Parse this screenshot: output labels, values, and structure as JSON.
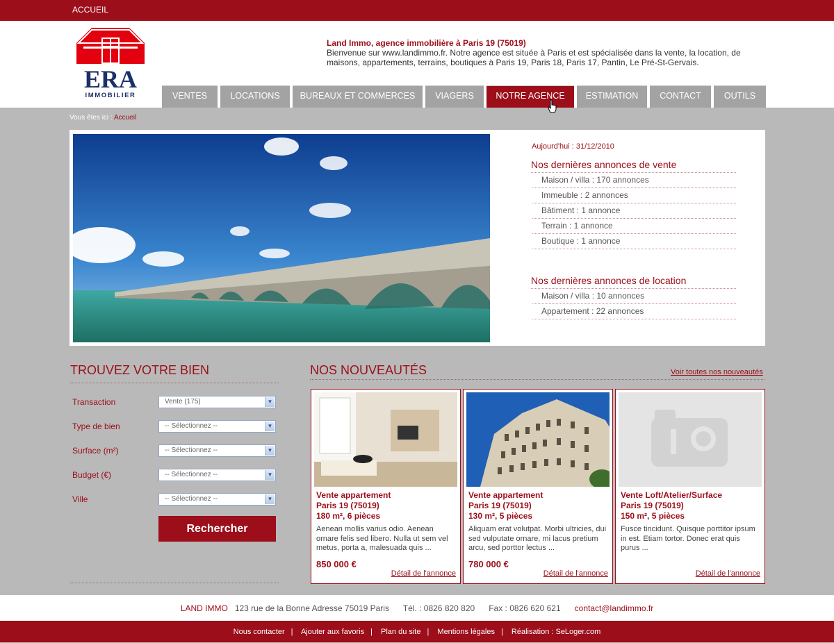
{
  "topbar": {
    "home_link": "ACCUEIL"
  },
  "logo": {
    "text": "ERA",
    "sub": "IMMOBILIER"
  },
  "intro": {
    "title": "Land Immo, agence immobilière à Paris 19 (75019)",
    "text": "Bienvenue sur www.landimmo.fr. Notre agence est située à Paris et est spécialisée dans la vente, la location, de maisons, appartements, terrains, boutiques à Paris 19, Paris 18, Paris 17, Pantin, Le Pré-St-Gervais."
  },
  "nav": [
    "VENTES",
    "LOCATIONS",
    "BUREAUX ET COMMERCES",
    "VIAGERS",
    "NOTRE AGENCE",
    "ESTIMATION",
    "CONTACT",
    "OUTILS"
  ],
  "breadcrumb": {
    "prefix": "Vous êtes ici :",
    "current": "Accueil"
  },
  "hero": {
    "date": "Aujourd'hui : 31/12/2010",
    "sales_title": "Nos dernières annonces de vente",
    "sales": [
      "Maison / villa : 170 annonces",
      "Immeuble : 2 annonces",
      "Bâtiment : 1 annonce",
      "Terrain : 1 annonce",
      "Boutique : 1 annonce"
    ],
    "rent_title": "Nos dernières annonces de location",
    "rent": [
      "Maison / villa : 10 annonces",
      "Appartement : 22 annonces"
    ]
  },
  "search": {
    "title": "TROUVEZ VOTRE BIEN",
    "fields": [
      {
        "label": "Transaction",
        "value": "Vente (175)"
      },
      {
        "label": "Type de bien",
        "value": "-- Sélectionnez --"
      },
      {
        "label": "Surface (m²)",
        "value": "-- Sélectionnez --"
      },
      {
        "label": "Budget (€)",
        "value": "-- Sélectionnez --"
      },
      {
        "label": "Ville",
        "value": "-- Sélectionnez --"
      }
    ],
    "button": "Rechercher"
  },
  "news": {
    "title": "NOS NOUVEAUTÉS",
    "see_all": "Voir toutes nos nouveautés",
    "cards": [
      {
        "type": "Vente appartement",
        "city": "Paris 19 (75019)",
        "size": "180 m², 6 pièces",
        "desc": "Aenean mollis varius odio. Aenean ornare felis sed libero. Nulla ut sem vel metus, porta a, malesuada quis ...",
        "price": "850 000 €",
        "link": "Détail de l'annonce"
      },
      {
        "type": "Vente appartement",
        "city": "Paris 19 (75019)",
        "size": "130 m², 5 pièces",
        "desc": "Aliquam erat volutpat. Morbi ultricies, dui sed vulputate ornare, mi lacus pretium arcu, sed porttor lectus ...",
        "price": "780 000 €",
        "link": "Détail de l'annonce"
      },
      {
        "type": "Vente Loft/Atelier/Surface",
        "city": "Paris 19 (75019)",
        "size": "150 m², 5 pièces",
        "desc": "Fusce tincidunt. Quisque porttitor ipsum in est. Etiam tortor. Donec erat quis purus ...",
        "price": "",
        "link": "Détail de l'annonce"
      }
    ]
  },
  "footer": {
    "agency": "LAND IMMO",
    "address": "123 rue de la Bonne Adresse 75019 Paris",
    "tel": "Tél. : 0826 820 820",
    "fax": "Fax : 0826 620 621",
    "email": "contact@landimmo.fr",
    "links": [
      "Nous contacter",
      "Ajouter aux favoris",
      "Plan du site",
      "Mentions légales",
      "Réalisation : SeLoger.com"
    ]
  },
  "colors": {
    "brand": "#9c0e19",
    "nav_inactive": "#a3a3a3",
    "background": "#b9b9b9"
  }
}
